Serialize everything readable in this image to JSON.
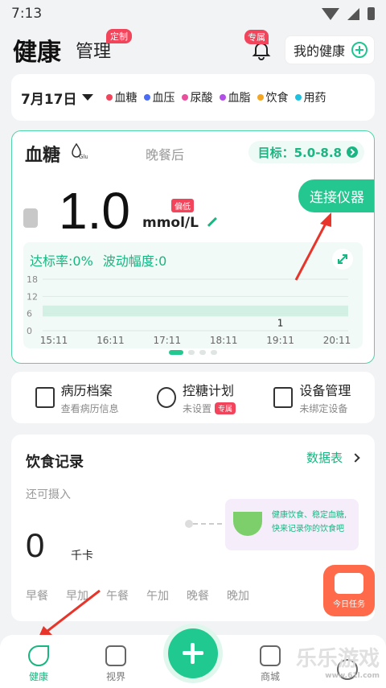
{
  "status_bar": {
    "time": "7:13"
  },
  "header": {
    "tab_health": "健康",
    "tab_manage": "管理",
    "badge_custom": "定制",
    "badge_exclusive": "专属",
    "my_health": "我的健康"
  },
  "filter": {
    "date": "7月17日",
    "legend": [
      {
        "label": "血糖",
        "color": "#f2445a"
      },
      {
        "label": "血压",
        "color": "#4a6cf7"
      },
      {
        "label": "尿酸",
        "color": "#e84f9c"
      },
      {
        "label": "血脂",
        "color": "#b34fe8"
      },
      {
        "label": "饮食",
        "color": "#f5a623"
      },
      {
        "label": "用药",
        "color": "#1fc1e0"
      }
    ]
  },
  "glucose": {
    "title": "血糖",
    "logo_text": "Glu",
    "meal": "晚餐后",
    "target": "目标：5.0-8.8",
    "value": "1.0",
    "low_badge": "偏低",
    "unit": "mmol/L",
    "connect": "连接仪器",
    "rate": "达标率:0%",
    "fluctuation": "波动幅度:0"
  },
  "chart_data": {
    "type": "line",
    "y_ticks": [
      "18",
      "12",
      "6",
      "0"
    ],
    "ylim": [
      0,
      18
    ],
    "target_band": [
      5.0,
      8.8
    ],
    "x": [
      "15:11",
      "16:11",
      "17:11",
      "18:11",
      "19:11",
      "20:11"
    ],
    "points": [
      {
        "x": "19:11",
        "y": 1.0,
        "label": "1"
      }
    ]
  },
  "tools": [
    {
      "title": "病历档案",
      "sub": "查看病历信息",
      "icon": "medical-record-icon"
    },
    {
      "title": "控糖计划",
      "sub": "未设置",
      "badge": "专属",
      "icon": "alarm-clock-icon"
    },
    {
      "title": "设备管理",
      "sub": "未绑定设备",
      "icon": "device-box-icon"
    }
  ],
  "diet": {
    "title": "饮食记录",
    "link": "数据表",
    "remain": "还可摄入",
    "value": "0",
    "unit": "千卡",
    "tip_line1": "健康饮食、稳定血糖,",
    "tip_line2": "快来记录你的饮食吧",
    "meals": [
      "早餐",
      "早加",
      "午餐",
      "午加",
      "晚餐",
      "晚加"
    ]
  },
  "task": {
    "label": "今日任务"
  },
  "nav": {
    "items": [
      {
        "label": "健康"
      },
      {
        "label": "视界"
      },
      {
        "label": ""
      },
      {
        "label": "商城"
      },
      {
        "label": ""
      }
    ]
  },
  "watermark": {
    "text": "乐乐游戏",
    "sub": "www.61l.com"
  }
}
